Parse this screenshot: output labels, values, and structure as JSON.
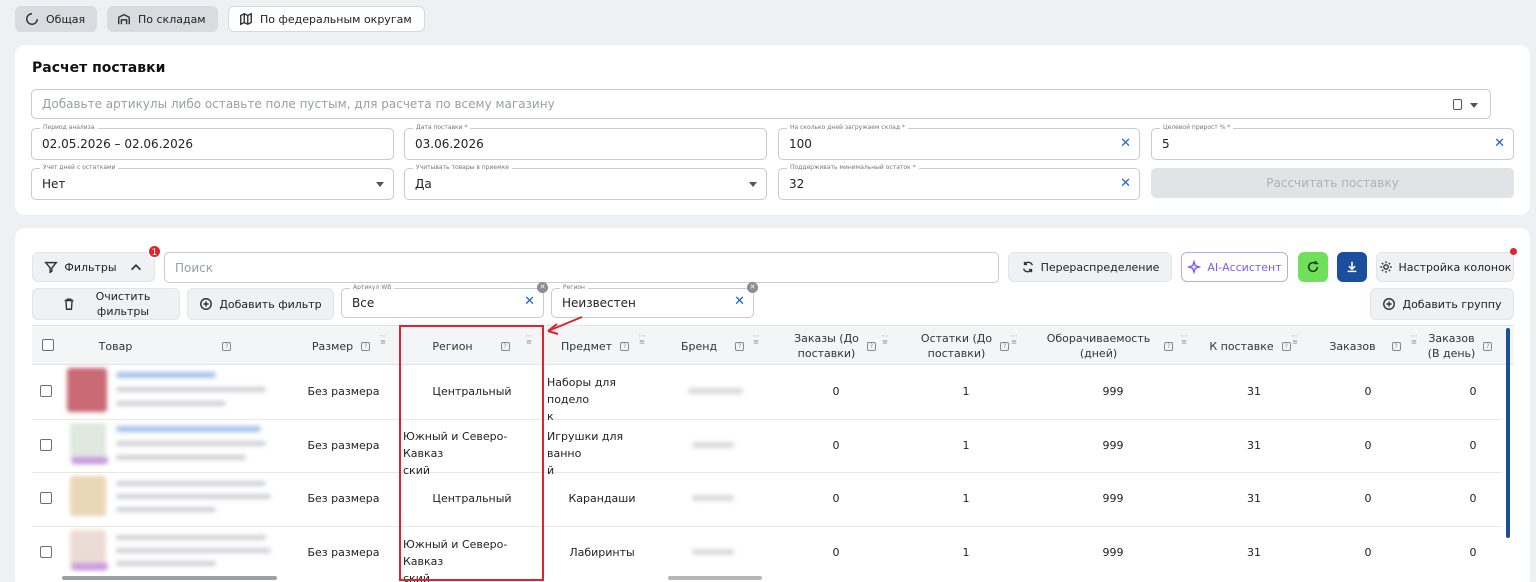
{
  "tabs": [
    {
      "label": "Общая",
      "icon": "circle-arc-icon"
    },
    {
      "label": "По складам",
      "icon": "warehouse-icon"
    },
    {
      "label": "По федеральным округам",
      "icon": "map-icon"
    }
  ],
  "calc": {
    "title": "Расчет поставки",
    "search_placeholder": "Добавьте артикулы либо оставьте поле пустым, для расчета по всему магазину",
    "fields": {
      "period": {
        "label": "Период анализа",
        "value": "02.05.2026 – 02.06.2026"
      },
      "delivery_date": {
        "label": "Дата поставки *",
        "value": "03.06.2026"
      },
      "days_loaded": {
        "label": "На сколько дней загружаем склад *",
        "value": "100"
      },
      "growth": {
        "label": "Целевой прирост % *",
        "value": "5"
      },
      "stock_days": {
        "label": "Учет дней с остатками",
        "value": "Нет"
      },
      "acceptance": {
        "label": "Учитывать товары в приемке",
        "value": "Да"
      },
      "min_stock": {
        "label": "Поддерживать минимальный остаток *",
        "value": "32"
      }
    },
    "calc_button": "Рассчитать поставку"
  },
  "toolbar": {
    "filters": "Фильтры",
    "filters_badge": "1",
    "search_placeholder": "Поиск",
    "redistribution": "Перераспределение",
    "ai": "AI-Ассистент",
    "columns": "Настройка колонок",
    "clear_filters_line1": "Очистить",
    "clear_filters_line2": "фильтры",
    "add_filter": "Добавить фильтр",
    "article_filter": {
      "label": "Артикул WB",
      "value": "Все"
    },
    "region_filter": {
      "label": "Регион",
      "value": "Неизвестен"
    },
    "add_group": "Добавить группу"
  },
  "table": {
    "headers": {
      "product": "Товар",
      "size": "Размер",
      "region": "Регион",
      "subject": "Предмет",
      "brand": "Бренд",
      "orders_before_l1": "Заказы (До",
      "orders_before_l2": "поставки)",
      "stock_before_l1": "Остатки (До",
      "stock_before_l2": "поставки)",
      "turnover_l1": "Оборачиваемость",
      "turnover_l2": "(дней)",
      "to_supply": "К поставке",
      "orders": "Заказов",
      "orders_day_l1": "Заказов",
      "orders_day_l2": "(В день)"
    },
    "rows": [
      {
        "size": "Без размера",
        "region_l1": "Центральный",
        "region_l2": "",
        "subject_l1": "Наборы для подело",
        "subject_l2": "к",
        "orders_before": "0",
        "stock_before": "1",
        "turnover": "999",
        "to_supply": "31",
        "orders": "0",
        "orders_day": "0"
      },
      {
        "size": "Без размера",
        "region_l1": "Южный и Северо-Кавказ",
        "region_l2": "ский",
        "subject_l1": "Игрушки для ванно",
        "subject_l2": "й",
        "orders_before": "0",
        "stock_before": "1",
        "turnover": "999",
        "to_supply": "31",
        "orders": "0",
        "orders_day": "0"
      },
      {
        "size": "Без размера",
        "region_l1": "Центральный",
        "region_l2": "",
        "subject_l1": "Карандаши",
        "subject_l2": "",
        "orders_before": "0",
        "stock_before": "1",
        "turnover": "999",
        "to_supply": "31",
        "orders": "0",
        "orders_day": "0"
      },
      {
        "size": "Без размера",
        "region_l1": "Южный и Северо-Кавказ",
        "region_l2": "ский",
        "subject_l1": "Лабиринты",
        "subject_l2": "",
        "orders_before": "0",
        "stock_before": "1",
        "turnover": "999",
        "to_supply": "31",
        "orders": "0",
        "orders_day": "0"
      }
    ]
  },
  "colors": {
    "accent": "#1e63c6",
    "highlight": "#e0242b",
    "ai": "#7b5cf0",
    "green": "#6ee05a"
  }
}
